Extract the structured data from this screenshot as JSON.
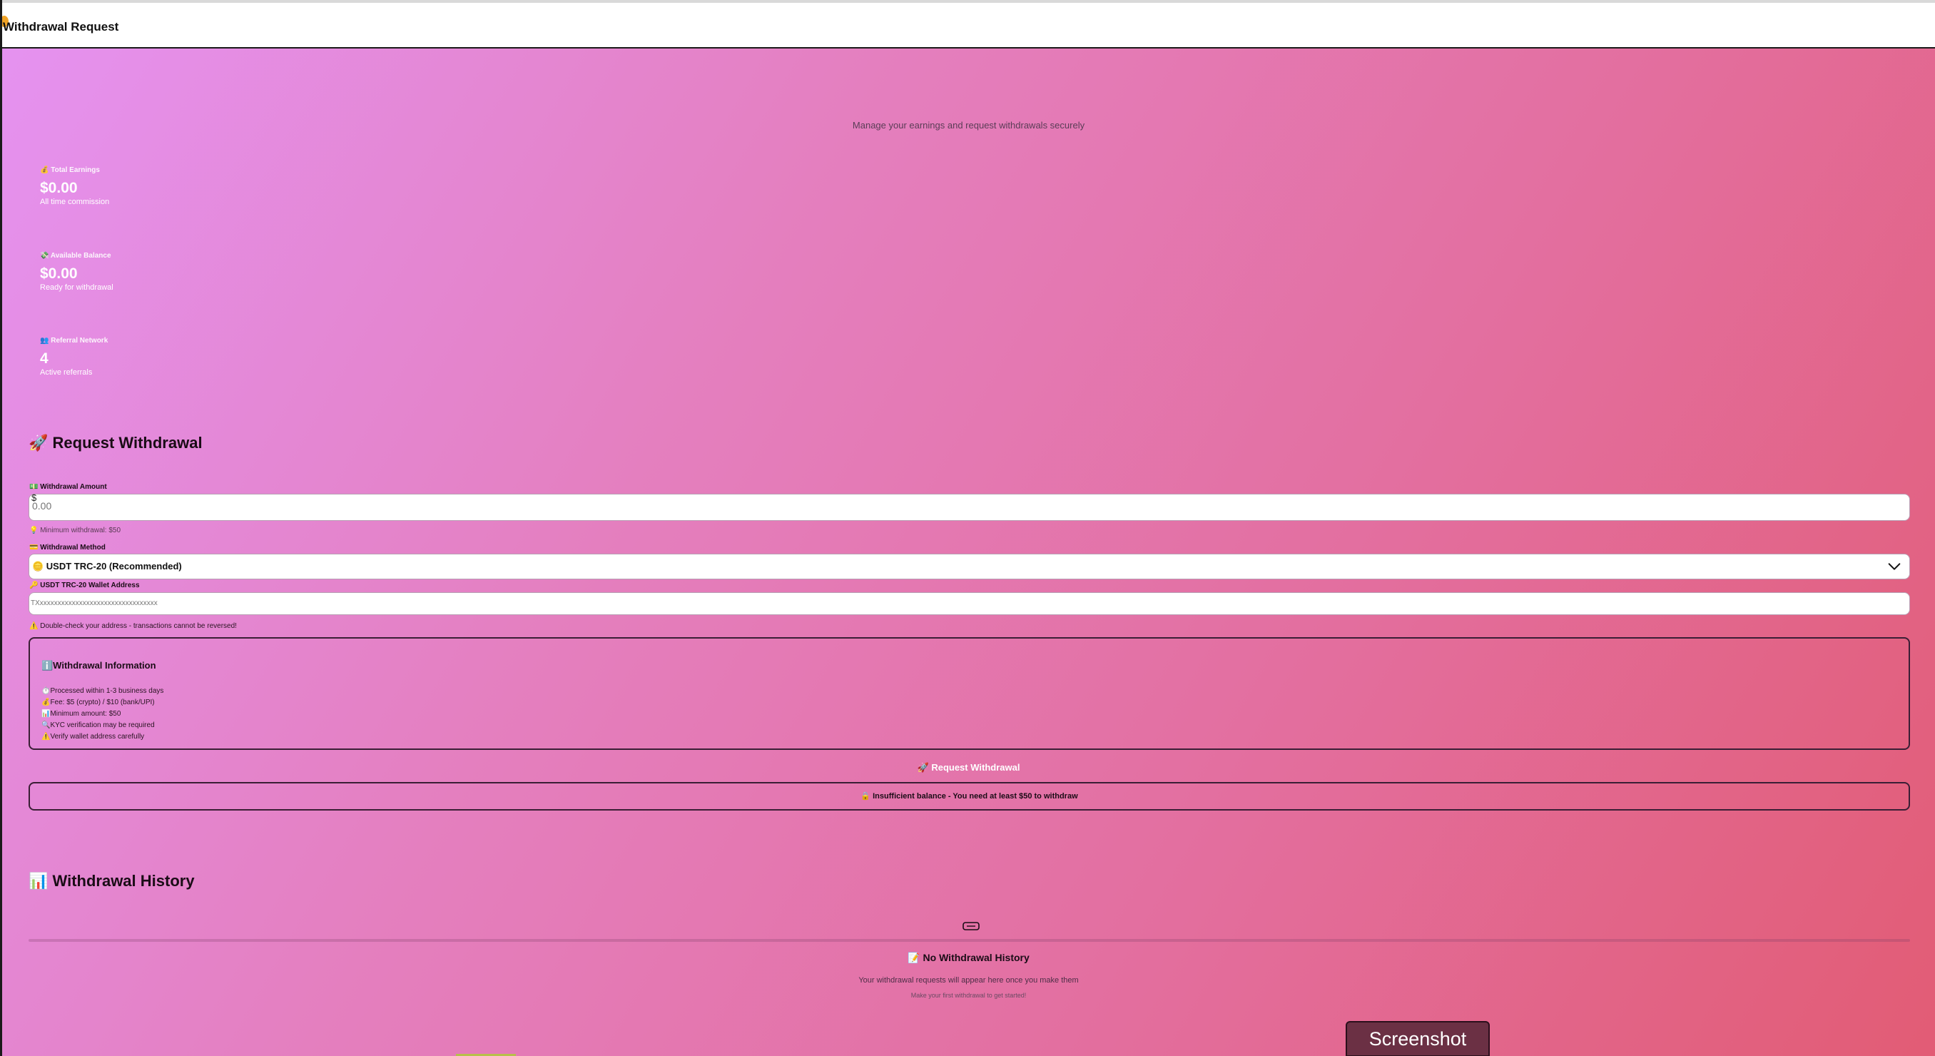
{
  "header": {
    "title": "Withdrawal Request"
  },
  "page": {
    "subtitle": "Manage your earnings and request withdrawals securely"
  },
  "stats": [
    {
      "label": "💰 Total Earnings",
      "value": "$0.00",
      "sub": "All time commission"
    },
    {
      "label": "💸 Available Balance",
      "value": "$0.00",
      "sub": "Ready for withdrawal"
    },
    {
      "label": "👥 Referral Network",
      "value": "4",
      "sub": "Active referrals"
    }
  ],
  "form": {
    "title": "🚀 Request Withdrawal",
    "amount_label": "💵 Withdrawal Amount",
    "amount_currency": "$",
    "amount_placeholder": "0.00",
    "min_hint": "💡 Minimum withdrawal: $50",
    "method_label": "💳 Withdrawal Method",
    "method_selected": "🪙 USDT TRC-20 (Recommended)",
    "wallet_label": "🔑 USDT TRC-20 Wallet Address",
    "wallet_placeholder": "TXxxxxxxxxxxxxxxxxxxxxxxxxxxxxxxxxx",
    "wallet_warning": "⚠️ Double-check your address - transactions cannot be reversed!"
  },
  "info": {
    "title": "ℹ️Withdrawal Information",
    "items": [
      "⏱️Processed within 1-3 business days",
      "💰Fee: $5 (crypto) / $10 (bank/UPI)",
      "📊Minimum amount: $50",
      "🔍KYC verification may be required",
      "⚠️Verify wallet address carefully"
    ]
  },
  "submit_label": "🚀 Request Withdrawal",
  "insufficient_msg": "🔒 Insufficient balance - You need at least $50 to withdraw",
  "history": {
    "title": "📊 Withdrawal History",
    "empty_title": "📝 No Withdrawal History",
    "empty_sub": "Your withdrawal requests will appear here once you make them",
    "empty_sub2": "Make your first withdrawal to get started!"
  },
  "screenshot_button": "Screenshot"
}
